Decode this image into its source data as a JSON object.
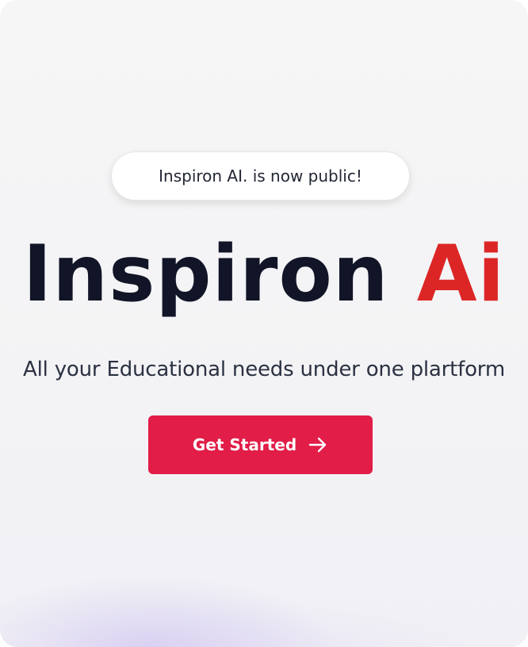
{
  "badge": {
    "text": "Inspiron AI. is now public!"
  },
  "hero": {
    "title_main": "Inspiron",
    "title_accent": "Ai",
    "subtitle": "All your Educational needs under one plartform"
  },
  "cta": {
    "label": "Get Started",
    "icon": "arrow-right-icon"
  },
  "colors": {
    "title": "#111527",
    "accent": "#dc2626",
    "button": "#e11d48",
    "subtitle": "#2b3142"
  }
}
